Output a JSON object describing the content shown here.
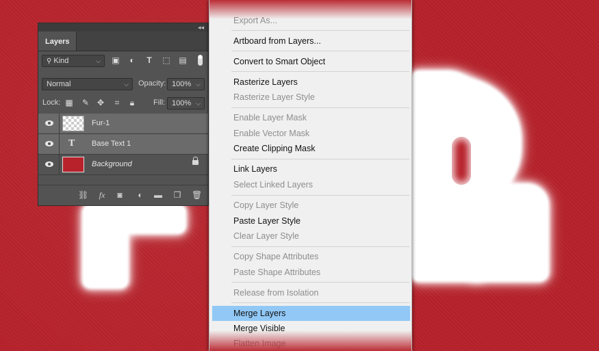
{
  "layers_panel": {
    "tab_label": "Layers",
    "filter_kind": "Kind",
    "blend_mode": "Normal",
    "opacity_label": "Opacity:",
    "opacity_value": "100%",
    "lock_label": "Lock:",
    "fill_label": "Fill:",
    "fill_value": "100%",
    "layers": [
      {
        "name": "Fur-1",
        "thumb": "transparent",
        "selected": true
      },
      {
        "name": "Base Text 1",
        "thumb": "text",
        "selected": true
      },
      {
        "name": "Background",
        "thumb": "red",
        "selected": false,
        "locked": true
      }
    ]
  },
  "context_menu": {
    "items": [
      {
        "label": "Export As...",
        "disabled": true
      },
      {
        "label": "Artboard from Layers...",
        "disabled": false
      },
      {
        "label": "Convert to Smart Object",
        "disabled": false
      },
      {
        "label": "Rasterize Layers",
        "disabled": false
      },
      {
        "label": "Rasterize Layer Style",
        "disabled": true
      },
      {
        "label": "Enable Layer Mask",
        "disabled": true
      },
      {
        "label": "Enable Vector Mask",
        "disabled": true
      },
      {
        "label": "Create Clipping Mask",
        "disabled": false
      },
      {
        "label": "Link Layers",
        "disabled": false
      },
      {
        "label": "Select Linked Layers",
        "disabled": true
      },
      {
        "label": "Copy Layer Style",
        "disabled": true
      },
      {
        "label": "Paste Layer Style",
        "disabled": false
      },
      {
        "label": "Clear Layer Style",
        "disabled": true
      },
      {
        "label": "Copy Shape Attributes",
        "disabled": true
      },
      {
        "label": "Paste Shape Attributes",
        "disabled": true
      },
      {
        "label": "Release from Isolation",
        "disabled": true
      },
      {
        "label": "Merge Layers",
        "disabled": false,
        "highlighted": true
      },
      {
        "label": "Merge Visible",
        "disabled": false
      },
      {
        "label": "Flatten Image",
        "disabled": true
      }
    ]
  },
  "colors": {
    "canvas_red": "#b8222b",
    "menu_highlight": "#91c8f6",
    "panel_bg": "#535353"
  }
}
